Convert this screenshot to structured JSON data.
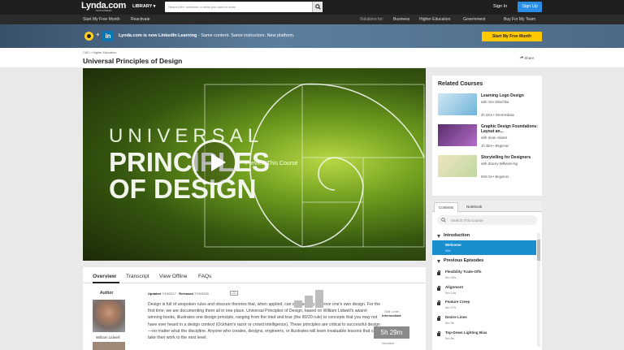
{
  "header": {
    "logo": "Lynda.com",
    "logo_sub": "FROM LINKEDIN",
    "library": "LIBRARY ▾",
    "search_placeholder": "Search 6K+ software or skills you want to learn",
    "sign_in": "Sign In",
    "sign_up": "Sign Up"
  },
  "subnav": {
    "start": "Start My Free Month",
    "reactivate": "Reactivate",
    "solutions": "Solutions for:",
    "business": "Business",
    "higher_ed": "Higher Education",
    "government": "Government",
    "buy": "Buy For My Team"
  },
  "banner": {
    "plus": "+",
    "in": "in",
    "title": "Lynda.com is now LinkedIn Learning",
    "rest": " - Same content. Same instructors. New platform.",
    "cta": "Start My Free Month"
  },
  "page": {
    "breadcrumb": "CAD  >  Higher Education",
    "title": "Universal Principles of Design",
    "share": "Share"
  },
  "video": {
    "line1": "UNIVERSAL",
    "line2": "PRINCIPLES",
    "line3": "OF DESIGN",
    "preview": "Preview This Course"
  },
  "tabs": [
    "Overview",
    "Transcript",
    "View Offline",
    "FAQs"
  ],
  "course": {
    "author_heading": "Author",
    "author_name": "William Lidwell",
    "updated_label": "Updated",
    "updated": "7/19/2017",
    "released_label": "Released",
    "released": "7/15/2015",
    "cc": "CC",
    "description": "Design is full of unspoken rules and obscure theories that, when applied, can dramatically improve one's own design. For the first time, we are documenting them all in one place. Universal Principles of Design, based on William Lidwell's award-winning books, illustrates one design principle, ranging from the tried and true (the 80/20 rule) to concepts that you may not have ever heard in a design context (Ockham's razor or crowd intelligence). These principles are critical to successful design—no matter what the discipline. Anyone who creates, designs, engineers, or illustrates will learn invaluable lessons that can take their work to the next level.",
    "skill_label": "Skill Level",
    "skill": "Intermediate",
    "duration": "5h 29m",
    "duration_label": "Duration"
  },
  "related": {
    "heading": "Related Courses",
    "items": [
      {
        "title": "Learning Logo Design",
        "author": "with Von Glitschka",
        "meta": "2h 34m • Intermediate",
        "color": "#6fb3d9"
      },
      {
        "title": "Graphic Design Foundations: Layout an...",
        "author": "with Sean Adams",
        "meta": "1h 35m • Beginner",
        "color": "#8a4fa0"
      },
      {
        "title": "Storytelling for Designers",
        "author": "with Stacey Williams-Ng",
        "meta": "59m 5s • Beginner",
        "color": "#e3d4a8"
      }
    ]
  },
  "toc": {
    "tab_contents": "Contents",
    "tab_notebook": "Notebook",
    "search_placeholder": "Search This Course",
    "chapter1": "Introduction",
    "chapter2": "Previous Episodes",
    "videos": [
      {
        "name": "Welcome",
        "length": "49s"
      },
      {
        "name": "Flexibility Trade-Offs",
        "length": "5m 32s"
      },
      {
        "name": "Alignment",
        "length": "5m 14s"
      },
      {
        "name": "Feature Creep",
        "length": "4m 27s"
      },
      {
        "name": "Desire Lines",
        "length": "5m 9s"
      },
      {
        "name": "Top-Down Lighting Bias",
        "length": "5m 8s"
      }
    ]
  }
}
